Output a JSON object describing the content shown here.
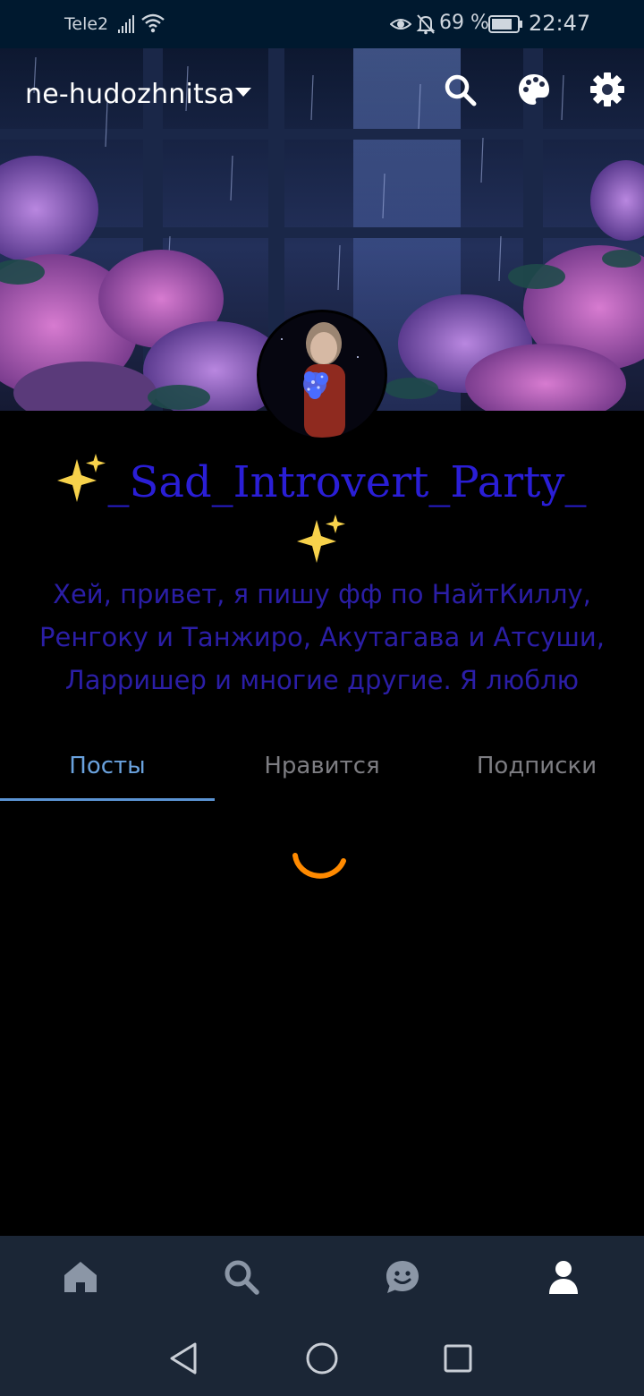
{
  "status_bar": {
    "carrier": "Tele2",
    "battery_percent": "69 %",
    "time": "22:47",
    "icons": [
      "signal-icon",
      "wifi-icon",
      "eye-icon",
      "bell-muted-icon",
      "battery-icon"
    ]
  },
  "header": {
    "blog_name": "ne-hudozhnitsa",
    "icons": [
      "chevron-down-icon",
      "search-icon",
      "palette-icon",
      "settings-icon"
    ]
  },
  "profile": {
    "title": "_Sad_Introvert_Party_",
    "title_prefix_emoji": "sparkles-icon",
    "title_suffix_emoji": "sparkles-icon",
    "description_lines": [
      "Хей, привет, я пишу фф по НайтКиллу,",
      "Ренгоку и Танжиро, Акутагава и Атсуши,",
      "Ларришер и многие другие. Я люблю"
    ],
    "title_color": "#2a1ed6",
    "description_color": "#2b1ea6"
  },
  "tabs": {
    "items": [
      {
        "label": "Посты",
        "active": true
      },
      {
        "label": "Нравится",
        "active": false
      },
      {
        "label": "Подписки",
        "active": false
      }
    ],
    "active_color": "#6aa2de"
  },
  "loading": {
    "spinner_color": "#ff8a00"
  },
  "bottom_nav": {
    "items": [
      "home-icon",
      "search-icon",
      "chat-icon",
      "account-icon"
    ],
    "active_item": "account-icon"
  },
  "system_nav": {
    "items": [
      "back-icon",
      "home-circle-icon",
      "recents-icon"
    ]
  }
}
